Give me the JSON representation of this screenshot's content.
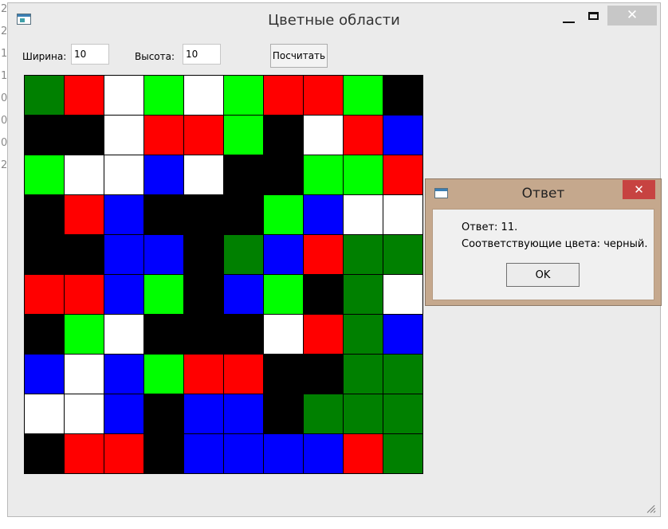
{
  "background_edge_chars": [
    "2",
    "2",
    "1",
    "1",
    "0",
    "0",
    "0",
    "2"
  ],
  "window": {
    "title": "Цветные области",
    "close_symbol": "✕",
    "controls": {
      "width_label": "Ширина:",
      "width_value": "10",
      "height_label": "Высота:",
      "height_value": "10",
      "calc_button": "Посчитать"
    }
  },
  "palette": {
    "DG": "#008000",
    "R": "#ff0000",
    "W": "#ffffff",
    "G": "#00ff00",
    "K": "#000000",
    "B": "#0000ff"
  },
  "grid": {
    "rows": [
      [
        "DG",
        "R",
        "W",
        "G",
        "W",
        "G",
        "R",
        "R",
        "G",
        "K"
      ],
      [
        "K",
        "K",
        "W",
        "R",
        "R",
        "G",
        "K",
        "W",
        "R",
        "B"
      ],
      [
        "G",
        "W",
        "W",
        "B",
        "W",
        "K",
        "K",
        "G",
        "G",
        "R"
      ],
      [
        "K",
        "R",
        "B",
        "K",
        "K",
        "K",
        "G",
        "B",
        "W",
        "W"
      ],
      [
        "K",
        "K",
        "B",
        "B",
        "K",
        "DG",
        "B",
        "R",
        "DG",
        "DG"
      ],
      [
        "R",
        "R",
        "B",
        "G",
        "K",
        "B",
        "G",
        "K",
        "DG",
        "W"
      ],
      [
        "K",
        "G",
        "W",
        "K",
        "K",
        "K",
        "W",
        "R",
        "DG",
        "B"
      ],
      [
        "B",
        "W",
        "B",
        "G",
        "R",
        "R",
        "K",
        "K",
        "DG",
        "DG"
      ],
      [
        "W",
        "W",
        "B",
        "K",
        "B",
        "B",
        "K",
        "DG",
        "DG",
        "DG"
      ],
      [
        "K",
        "R",
        "R",
        "K",
        "B",
        "B",
        "B",
        "B",
        "R",
        "DG"
      ]
    ]
  },
  "dialog": {
    "title": "Ответ",
    "close_symbol": "✕",
    "line1": "Ответ: 11.",
    "line2": "Соответствующие цвета: черный.",
    "ok_label": "OK"
  }
}
